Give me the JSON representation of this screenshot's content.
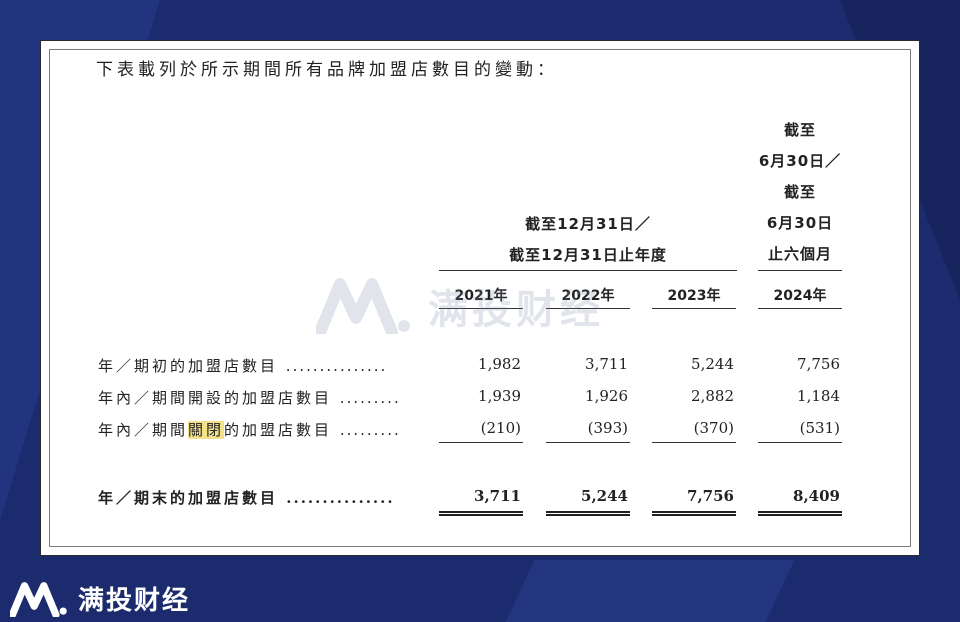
{
  "intro": "下表載列於所示期間所有品牌加盟店數目的變動：",
  "headers": {
    "period_group_lines": [
      "截至12月31日／",
      "截至12月31日止年度"
    ],
    "interim_lines": [
      "截至",
      "6月30日／",
      "截至",
      "6月30日",
      "止六個月"
    ],
    "years": [
      "2021年",
      "2022年",
      "2023年",
      "2024年"
    ]
  },
  "rows": [
    {
      "label": "年／期初的加盟店數目",
      "dots": "...............",
      "values": [
        "1,982",
        "3,711",
        "5,244",
        "7,756"
      ]
    },
    {
      "label": "年內／期間開設的加盟店數目",
      "dots": ".........",
      "values": [
        "1,939",
        "1,926",
        "2,882",
        "1,184"
      ]
    },
    {
      "label_pre": "年內／期間",
      "label_highlight": "關閉",
      "label_post": "的加盟店數目",
      "dots": ".........",
      "values": [
        "(210)",
        "(393)",
        "(370)",
        "(531)"
      ]
    },
    {
      "label": "年／期末的加盟店數目",
      "dots": "...............",
      "values": [
        "3,711",
        "5,244",
        "7,756",
        "8,409"
      ]
    }
  ],
  "watermark": {
    "text": "满投财经",
    "icon": "mantou-logo-icon"
  },
  "footer": {
    "text": "满投财经",
    "icon": "mantou-logo-icon"
  },
  "colors": {
    "background": "#1c2b6e",
    "highlight": "#f3e28a",
    "watermark": "#7b8ea8"
  }
}
